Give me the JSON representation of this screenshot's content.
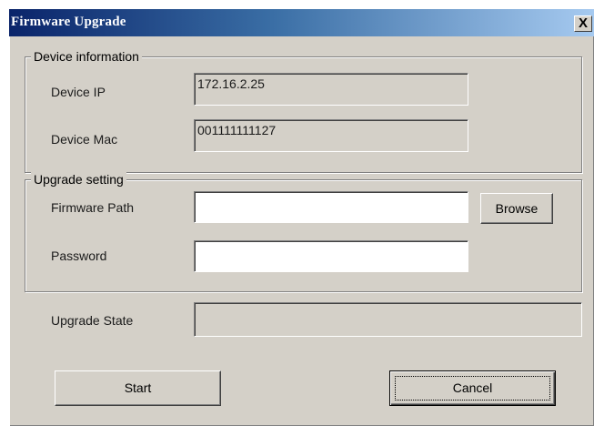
{
  "window": {
    "title": "Firmware Upgrade",
    "close_label": "X"
  },
  "device_info": {
    "legend": "Device information",
    "ip_label": "Device IP",
    "ip_value": "172.16.2.25",
    "mac_label": "Device Mac",
    "mac_value": "001111111127"
  },
  "upgrade_setting": {
    "legend": "Upgrade setting",
    "firmware_path_label": "Firmware Path",
    "firmware_path_value": "",
    "browse_label": "Browse",
    "password_label": "Password",
    "password_value": ""
  },
  "upgrade_state": {
    "label": "Upgrade State",
    "value": ""
  },
  "actions": {
    "start_label": "Start",
    "cancel_label": "Cancel"
  }
}
